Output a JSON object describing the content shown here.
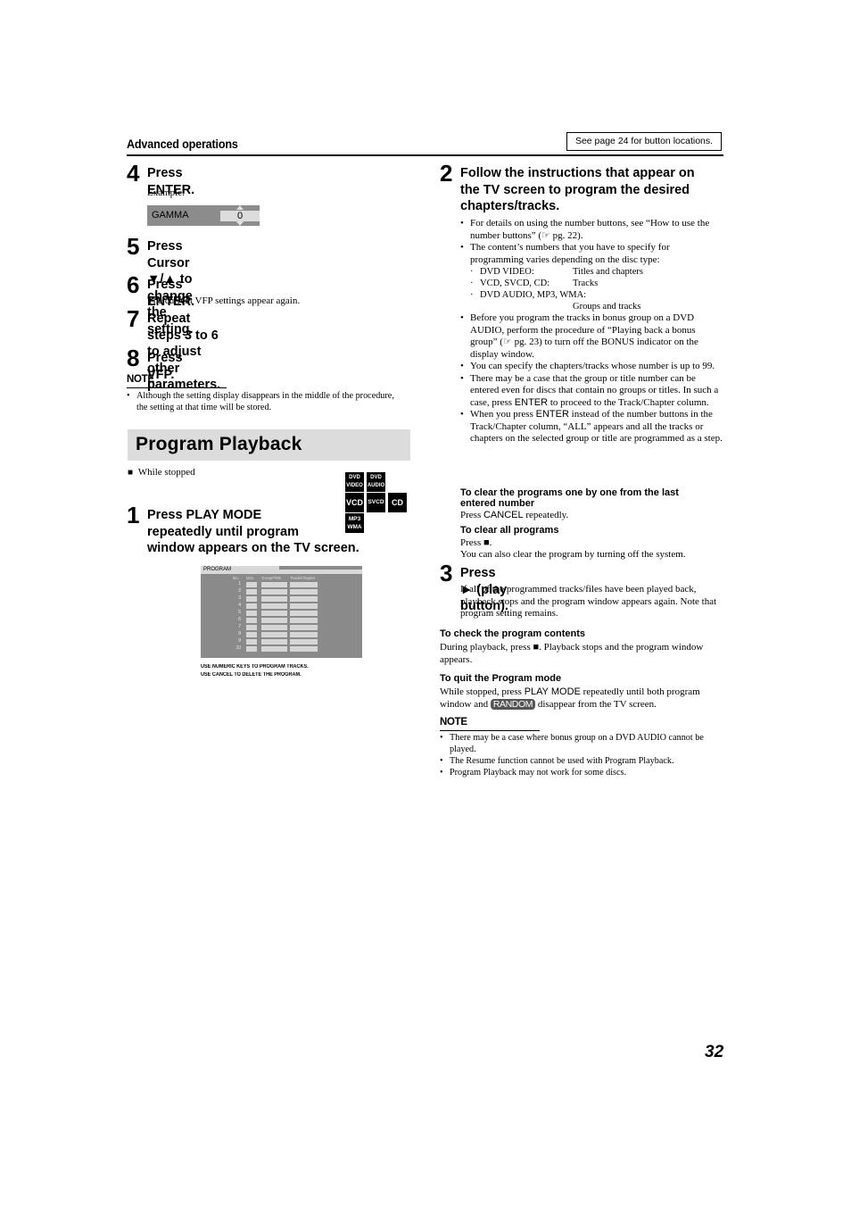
{
  "header": {
    "section_title": "Advanced operations",
    "see_page_note": "See page 24 for button locations."
  },
  "left_column": {
    "step4": {
      "number": "4",
      "title": "Press ENTER.",
      "example_label": "Example:",
      "gamma_label": "GAMMA",
      "gamma_value": "0"
    },
    "step5": {
      "number": "5",
      "title_line1": "Press Cursor ▼/▲ to change the",
      "title_line2": "setting."
    },
    "step6": {
      "number": "6",
      "title": "Press ENTER.",
      "body": "The current VFP settings appear again."
    },
    "step7": {
      "number": "7",
      "title_line1": "Repeat steps 3 to 6 to adjust other",
      "title_line2": "parameters."
    },
    "step8": {
      "number": "8",
      "title": "Press VFP."
    },
    "note": {
      "heading": "NOTE",
      "items": [
        "Although the setting display disappears in the middle of the procedure, the setting at that time will be stored."
      ]
    },
    "program_playback": {
      "banner_title": "Program Playback",
      "condition": "While stopped",
      "condition_icon": "■",
      "disc_badges": {
        "dvd_video": [
          "DVD",
          "VIDEO"
        ],
        "dvd_audio": [
          "DVD",
          "AUDIO"
        ],
        "vcd": "VCD",
        "svcd": "SVCD",
        "cd": "CD",
        "mp3_wma": [
          "MP3",
          "WMA"
        ]
      },
      "step1": {
        "number": "1",
        "title_line1": "Press PLAY MODE",
        "title_line2": "repeatedly until program",
        "title_line3": "window appears on the TV screen."
      },
      "program_window": {
        "tab_label": "PROGRAM",
        "columns": [
          "No.",
          "Disc",
          "Group/Title",
          "Track/Chapter"
        ],
        "rows": [
          "1",
          "2",
          "3",
          "4",
          "5",
          "6",
          "7",
          "8",
          "9",
          "10"
        ],
        "caption_line1": "USE NUMERIC KEYS TO PROGRAM TRACKS.",
        "caption_line2": "USE CANCEL TO DELETE THE PROGRAM."
      }
    }
  },
  "right_column": {
    "step2": {
      "number": "2",
      "title_line1": "Follow the instructions that appear on",
      "title_line2": "the TV screen to program the desired",
      "title_line3": "chapters/tracks.",
      "bullets": [
        "For details on using the number buttons, see “How to use the number buttons” (☞ pg. 22).",
        "The content’s numbers that you have to specify for programming varies depending on the disc type:"
      ],
      "disc_types": [
        {
          "disc": "DVD VIDEO:",
          "content": "Titles and chapters"
        },
        {
          "disc": "VCD, SVCD, CD:",
          "content": "Tracks"
        },
        {
          "disc": "DVD AUDIO, MP3, WMA:",
          "content": "Groups and tracks"
        }
      ],
      "bullets2": [
        "Before you program the tracks in bonus group on a DVD AUDIO, perform the procedure of “Playing back a bonus group” (☞ pg. 23) to turn off the BONUS indicator on the display window.",
        "You can specify the chapters/tracks whose number is up to 99."
      ],
      "bullet_enter_1_before": "There may be a case that the group or title number can be entered even for discs that contain no groups or titles. In such a case,  press ",
      "bullet_enter_1_key": "ENTER",
      "bullet_enter_1_after": " to proceed to the Track/Chapter column.",
      "bullet_enter_2_before": "When you press ",
      "bullet_enter_2_key": "ENTER",
      "bullet_enter_2_after": " instead of the number buttons in the Track/Chapter column, “ALL” appears and all the tracks or chapters on the selected group or title are programmed as a step.",
      "clear_one": {
        "heading": "To clear the programs one by one from the last entered number",
        "body_before": "Press ",
        "body_key": "CANCEL",
        "body_after": " repeatedly."
      },
      "clear_all": {
        "heading": "To clear all programs",
        "body_line1": "Press ■.",
        "body_line2": "You can also clear the program by turning off the system."
      }
    },
    "step3": {
      "number": "3",
      "title": "Press ► (play button).",
      "body": "If all of the programmed tracks/files have been played back, playback stops and the program window appears again. Note that program setting remains."
    },
    "check_contents": {
      "heading": "To check the program contents",
      "body": "During playback, press ■. Playback stops and the program window appears."
    },
    "quit_mode": {
      "heading": "To quit the Program mode",
      "body_before": "While stopped, press ",
      "body_key": "PLAY MODE",
      "body_middle": " repeatedly until both program window and ",
      "random_label": "RANDOM",
      "body_after": " disappear from the TV screen."
    },
    "note": {
      "heading": "NOTE",
      "items": [
        "There may be a case where bonus group on a DVD AUDIO cannot be played.",
        "The Resume function cannot be used with Program Playback.",
        "Program Playback may not work for some discs."
      ]
    }
  },
  "footer": {
    "page_number": "32"
  }
}
